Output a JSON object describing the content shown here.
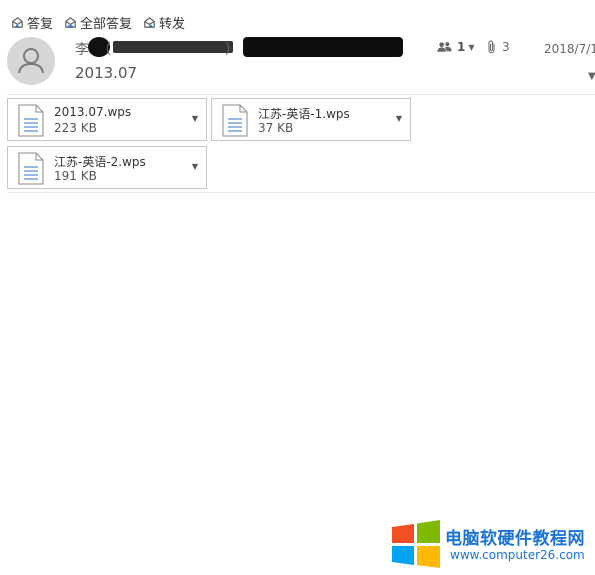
{
  "toolbar": {
    "reply_label": "答复",
    "reply_all_label": "全部答复",
    "forward_label": "转发"
  },
  "header": {
    "sender_name": "李",
    "sender_paren_open": "（",
    "sender_paren_close": "）",
    "subject": "2013.07",
    "recipients_count": "1",
    "attachments_count": "3",
    "date": "2018/7/1"
  },
  "attachments": [
    {
      "name": "2013.07.wps",
      "size": "223 KB"
    },
    {
      "name": "江苏-英语-1.wps",
      "size": "37 KB"
    },
    {
      "name": "江苏-英语-2.wps",
      "size": "191 KB"
    }
  ],
  "watermark": {
    "title": "电脑软硬件教程网",
    "url": "www.computer26.com"
  },
  "colors": {
    "accent": "#1a73d9",
    "file_icon_lines": "#5b8fd6",
    "border": "#c8c8c8"
  }
}
